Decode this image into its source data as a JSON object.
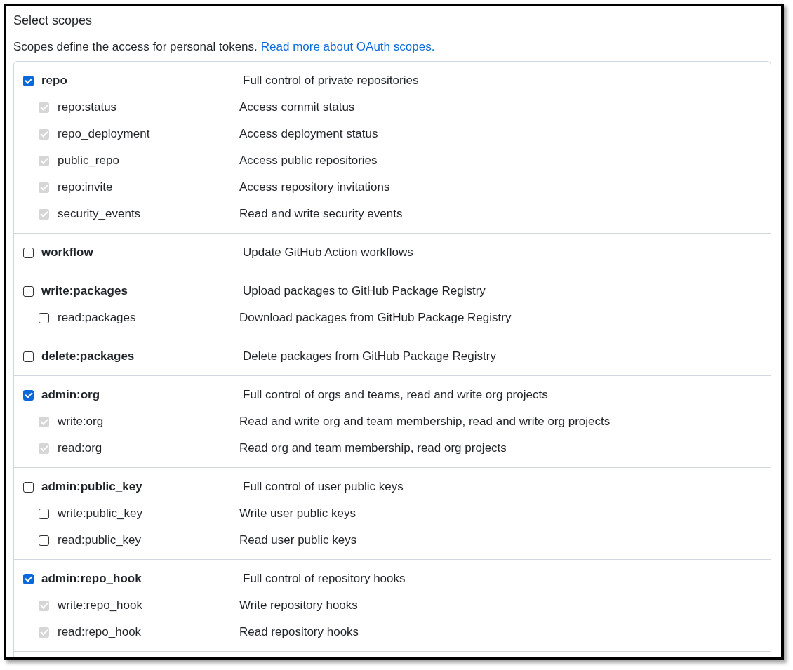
{
  "heading": "Select scopes",
  "intro": {
    "text": "Scopes define the access for personal tokens.",
    "link": "Read more about OAuth scopes."
  },
  "groups": [
    {
      "name": "repo",
      "description": "Full control of private repositories",
      "checked": true,
      "children": [
        {
          "name": "repo:status",
          "description": "Access commit status",
          "checked": true,
          "disabled": true
        },
        {
          "name": "repo_deployment",
          "description": "Access deployment status",
          "checked": true,
          "disabled": true
        },
        {
          "name": "public_repo",
          "description": "Access public repositories",
          "checked": true,
          "disabled": true
        },
        {
          "name": "repo:invite",
          "description": "Access repository invitations",
          "checked": true,
          "disabled": true
        },
        {
          "name": "security_events",
          "description": "Read and write security events",
          "checked": true,
          "disabled": true
        }
      ]
    },
    {
      "name": "workflow",
      "description": "Update GitHub Action workflows",
      "checked": false
    },
    {
      "name": "write:packages",
      "description": "Upload packages to GitHub Package Registry",
      "checked": false,
      "children": [
        {
          "name": "read:packages",
          "description": "Download packages from GitHub Package Registry",
          "checked": false,
          "disabled": false
        }
      ]
    },
    {
      "name": "delete:packages",
      "description": "Delete packages from GitHub Package Registry",
      "checked": false
    },
    {
      "name": "admin:org",
      "description": "Full control of orgs and teams, read and write org projects",
      "checked": true,
      "children": [
        {
          "name": "write:org",
          "description": "Read and write org and team membership, read and write org projects",
          "checked": true,
          "disabled": true
        },
        {
          "name": "read:org",
          "description": "Read org and team membership, read org projects",
          "checked": true,
          "disabled": true
        }
      ]
    },
    {
      "name": "admin:public_key",
      "description": "Full control of user public keys",
      "checked": false,
      "children": [
        {
          "name": "write:public_key",
          "description": "Write user public keys",
          "checked": false,
          "disabled": false
        },
        {
          "name": "read:public_key",
          "description": "Read user public keys",
          "checked": false,
          "disabled": false
        }
      ]
    },
    {
      "name": "admin:repo_hook",
      "description": "Full control of repository hooks",
      "checked": true,
      "children": [
        {
          "name": "write:repo_hook",
          "description": "Write repository hooks",
          "checked": true,
          "disabled": true
        },
        {
          "name": "read:repo_hook",
          "description": "Read repository hooks",
          "checked": true,
          "disabled": true
        }
      ]
    }
  ]
}
